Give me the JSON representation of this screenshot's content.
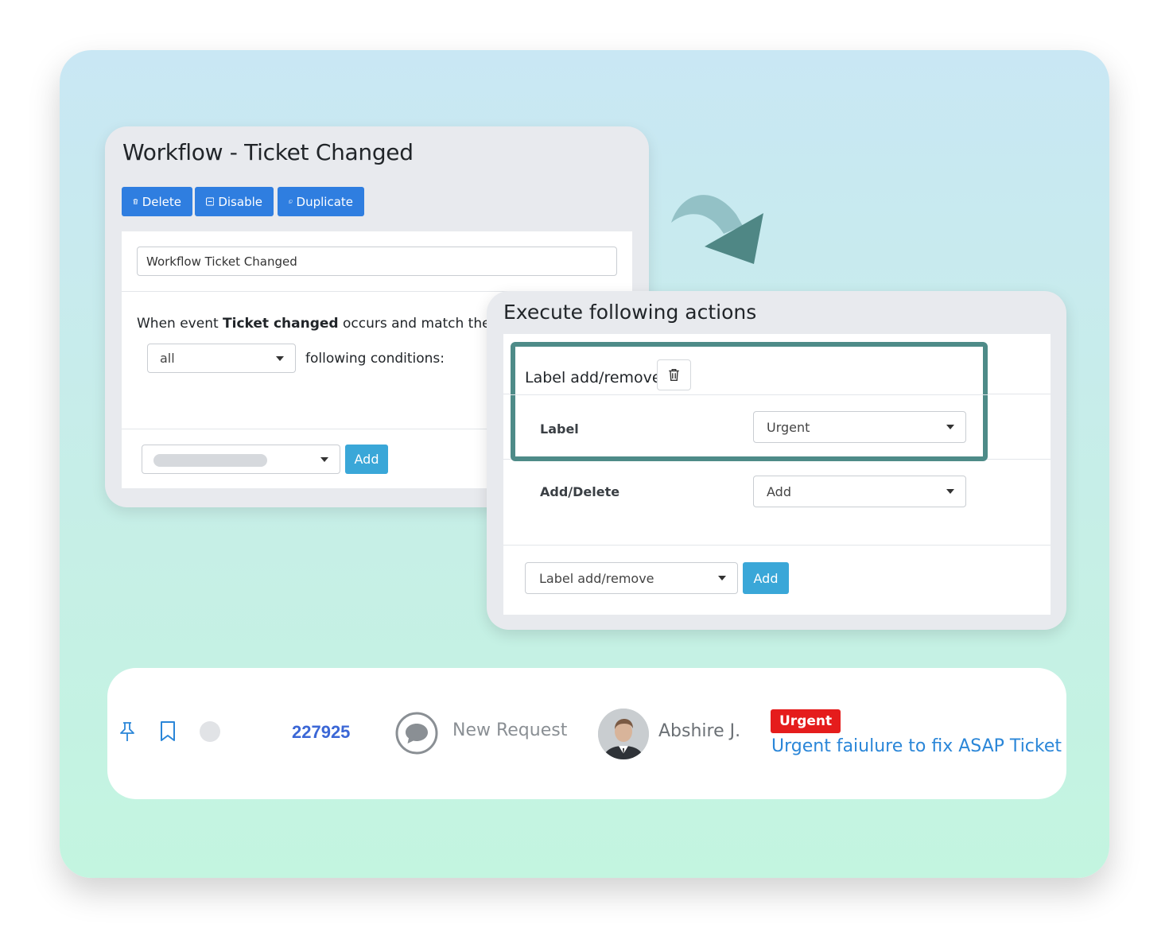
{
  "workflow": {
    "title": "Workflow - Ticket Changed",
    "buttons": {
      "delete": "Delete",
      "disable": "Disable",
      "duplicate": "Duplicate"
    },
    "name_value": "Workflow Ticket Changed",
    "condition_prefix": "When event ",
    "condition_event": "Ticket changed",
    "condition_suffix": " occurs and match the",
    "match_select": "all",
    "following_conditions": "following conditions:",
    "add_button": "Add"
  },
  "actions": {
    "title": "Execute following actions",
    "action_name": "Label add/remove",
    "label_field": "Label",
    "label_value": "Urgent",
    "add_delete_field": "Add/Delete",
    "add_delete_value": "Add",
    "new_action_select": "Label add/remove",
    "add_button": "Add"
  },
  "ticket": {
    "id": "227925",
    "status": "New Request",
    "agent": "Abshire J.",
    "badge": "Urgent",
    "subject": "Urgent faiulure to fix ASAP Ticket"
  },
  "colors": {
    "primary_button": "#2f7ee0",
    "add_button": "#3aa7d8",
    "highlight_border": "#4e8b88",
    "arrow_fill": "#4f8785",
    "urgent_badge": "#e51c1c",
    "ticket_id": "#3b67d6",
    "subject_link": "#2a86d8"
  },
  "icons": {
    "delete": "trash-icon",
    "disable": "minus-square-icon",
    "duplicate": "copy-icon",
    "pin": "pin-icon",
    "bookmark": "bookmark-icon",
    "status_dot": "status-dot-icon",
    "chat": "chat-bubble-icon"
  }
}
